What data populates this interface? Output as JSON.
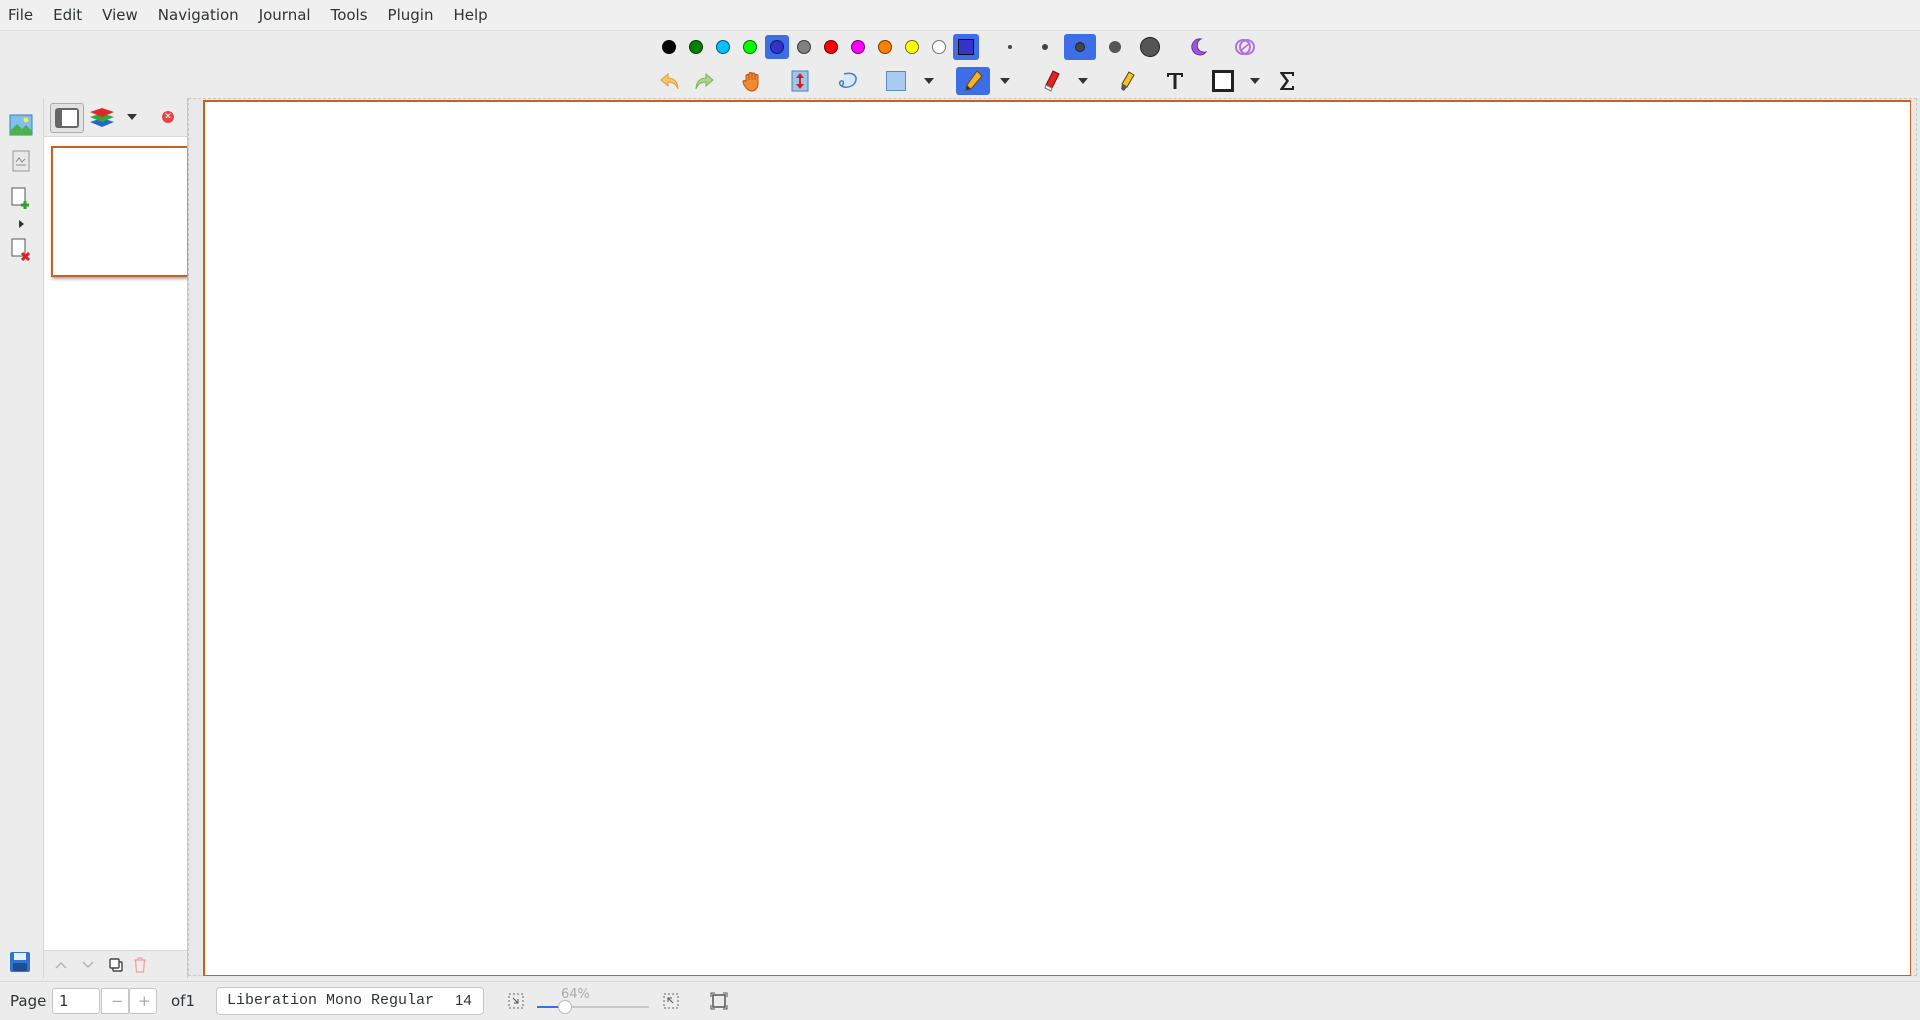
{
  "menu": [
    "File",
    "Edit",
    "View",
    "Navigation",
    "Journal",
    "Tools",
    "Plugin",
    "Help"
  ],
  "colors": {
    "palette": [
      "#000000",
      "#008000",
      "#00c0ff",
      "#00ff00",
      "#3333cc",
      "#808080",
      "#ff0000",
      "#ff00ff",
      "#ff8000",
      "#ffff00",
      "#ffffff"
    ],
    "selected_color": "#3333cc",
    "accent": "#3d6ee8",
    "page_border": "#c4621f"
  },
  "toolbar1": {
    "tools": [
      "select-rect-color-icon",
      "dot-fine-icon",
      "dot-medium-icon",
      "dot-thick-selected-icon",
      "dot-big-icon",
      "dot-huge-icon",
      "fill-icon",
      "fill-opacity-icon"
    ]
  },
  "toolbar2": {
    "tools": [
      "undo-icon",
      "redo-icon",
      "hand-icon",
      "vertical-space-icon",
      "lasso-select-icon",
      "rect-select-icon",
      "pen-icon",
      "eraser-icon",
      "highlighter-icon",
      "text-icon",
      "shape-icon",
      "math-tex-icon"
    ]
  },
  "sidebar": {
    "page_count": 1,
    "header_icons": [
      "page-preview-icon",
      "layers-icon"
    ]
  },
  "statusbar": {
    "page_label": "Page",
    "page_value": "1",
    "of_label": "of1",
    "font_name": "Liberation Mono Regular",
    "font_size": "14",
    "zoom": "64%",
    "zoom_fraction": 0.25
  }
}
